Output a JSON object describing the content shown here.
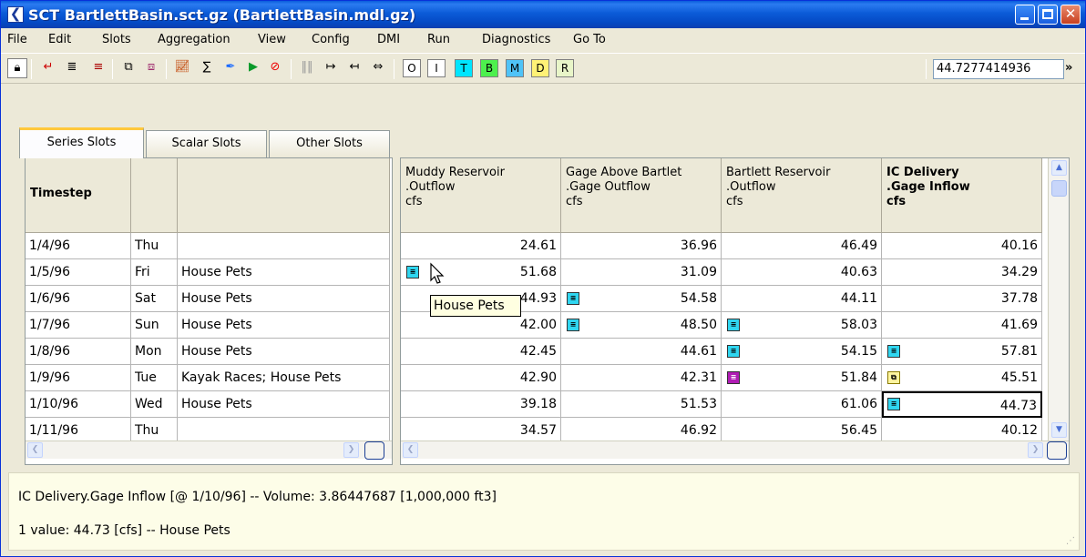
{
  "window": {
    "title": "SCT BartlettBasin.sct.gz (BartlettBasin.mdl.gz)",
    "accent": "#0a5ddc"
  },
  "menu": [
    "File",
    "Edit",
    "Slots",
    "Aggregation",
    "View",
    "Config",
    "DMI",
    "Run",
    "Diagnostics",
    "Go To"
  ],
  "toolbar": {
    "letters": [
      "O",
      "I",
      "T",
      "B",
      "M",
      "D",
      "R"
    ],
    "letter_colors": {
      "T": "#00e5ff",
      "B": "#4df04d",
      "M": "#4fc3f7",
      "D": "#fff176",
      "R": "#e8f5c8"
    },
    "value": "44.7277414936",
    "more": "»"
  },
  "tabs": [
    "Series Slots",
    "Scalar Slots",
    "Other Slots"
  ],
  "left_table": {
    "header": "Timestep",
    "rows": [
      {
        "date": "1/4/96",
        "day": "Thu",
        "note": ""
      },
      {
        "date": "1/5/96",
        "day": "Fri",
        "note": "House Pets"
      },
      {
        "date": "1/6/96",
        "day": "Sat",
        "note": "House Pets"
      },
      {
        "date": "1/7/96",
        "day": "Sun",
        "note": "House Pets"
      },
      {
        "date": "1/8/96",
        "day": "Mon",
        "note": "House Pets"
      },
      {
        "date": "1/9/96",
        "day": "Tue",
        "note": "Kayak Races; House Pets"
      },
      {
        "date": "1/10/96",
        "day": "Wed",
        "note": "House Pets"
      },
      {
        "date": "1/11/96",
        "day": "Thu",
        "note": ""
      }
    ]
  },
  "right_table": {
    "columns": [
      {
        "l1": "Muddy Reservoir",
        "l2": ".Outflow",
        "l3": "cfs"
      },
      {
        "l1": "Gage Above Bartlet",
        "l2": ".Gage Outflow",
        "l3": "cfs"
      },
      {
        "l1": "Bartlett Reservoir",
        "l2": ".Outflow",
        "l3": "cfs"
      },
      {
        "l1": "IC Delivery",
        "l2": ".Gage Inflow",
        "l3": "cfs"
      }
    ],
    "rows": [
      [
        "24.61",
        "36.96",
        "46.49",
        "40.16"
      ],
      [
        "51.68",
        "31.09",
        "40.63",
        "34.29"
      ],
      [
        "44.93",
        "54.58",
        "44.11",
        "37.78"
      ],
      [
        "42.00",
        "48.50",
        "58.03",
        "41.69"
      ],
      [
        "42.45",
        "44.61",
        "54.15",
        "57.81"
      ],
      [
        "42.90",
        "42.31",
        "51.84",
        "45.51"
      ],
      [
        "39.18",
        "51.53",
        "61.06",
        "44.73"
      ],
      [
        "34.57",
        "46.92",
        "56.45",
        "40.12"
      ]
    ]
  },
  "tooltip": "House Pets",
  "status": {
    "line1": "IC Delivery.Gage Inflow [@ 1/10/96] -- Volume: 3.86447687 [1,000,000 ft3]",
    "line2": "1 value:  44.73 [cfs] -- House Pets"
  }
}
